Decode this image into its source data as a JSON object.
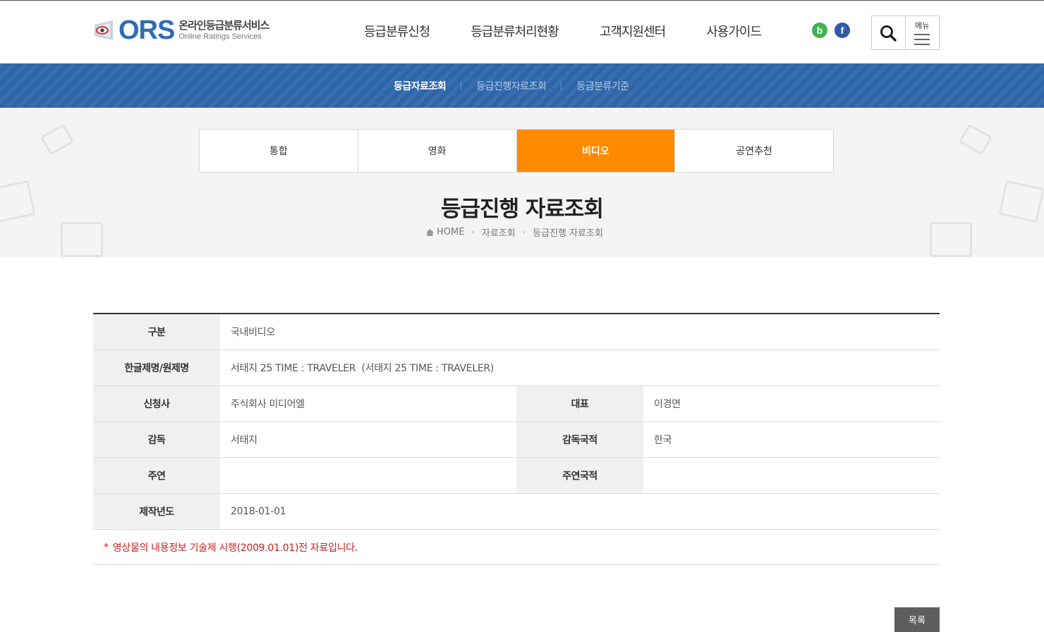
{
  "logo": {
    "brand": "ORS",
    "title_ko": "온라인등급분류서비스",
    "title_en": "Online Ratings Services"
  },
  "gnb": [
    "등급분류신청",
    "등급분류처리현황",
    "고객지원센터",
    "사용가이드"
  ],
  "sns": {
    "blog": "b",
    "facebook": "f"
  },
  "util": {
    "menu_label": "메뉴"
  },
  "subnav": [
    "등급자료조회",
    "등급진행자료조회",
    "등급분류기준"
  ],
  "tabs": [
    "통합",
    "영화",
    "비디오",
    "공연추천"
  ],
  "active_tab": "비디오",
  "page_title": "등급진행 자료조회",
  "breadcrumb": [
    "HOME",
    "자료조회",
    "등급진행 자료조회"
  ],
  "info": {
    "category_label": "구분",
    "category": "국내비디오",
    "title_label": "한글제명/원제명",
    "title": "서태지 25 TIME : TRAVELER  (서태지 25 TIME : TRAVELER)",
    "applicant_label": "신청사",
    "applicant": "주식회사 미디어엘",
    "rep_label": "대표",
    "rep": "이경면",
    "director_label": "감독",
    "director": "서태지",
    "director_nat_label": "감독국적",
    "director_nat": "한국",
    "cast_label": "주연",
    "cast": "",
    "cast_nat_label": "주연국적",
    "cast_nat": "",
    "year_label": "제작년도",
    "year": "2018-01-01"
  },
  "notice": {
    "star": "*",
    "text": "영상물의 내용정보 기술제 시행(2009.01.01)전 자료입니다."
  },
  "list_button": "목록",
  "colors": {
    "primary_blue": "#2f68ad",
    "accent_orange": "#ff8a00",
    "notice_red": "#d01d1d",
    "logo_blue": "#2d6cb5"
  }
}
